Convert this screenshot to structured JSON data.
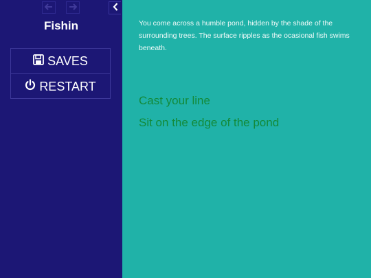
{
  "sidebar": {
    "story_title": "Fishin",
    "menu": [
      {
        "label": "SAVES",
        "icon": "save-icon"
      },
      {
        "label": "RESTART",
        "icon": "power-icon"
      }
    ],
    "nav": {
      "back_icon": "arrow-left-icon",
      "forward_icon": "arrow-right-icon",
      "collapse_icon": "chevron-left-icon"
    }
  },
  "passage": {
    "text": "You come across a humble pond, hidden by the shade of the surrounding trees. The surface ripples as the ocasional fish swims beneath."
  },
  "choices": [
    {
      "label": "Cast your line"
    },
    {
      "label": "Sit on the edge of the pond"
    }
  ],
  "colors": {
    "sidebar_bg": "#1c1775",
    "main_bg": "#20b2a8",
    "link": "#138a3a"
  }
}
